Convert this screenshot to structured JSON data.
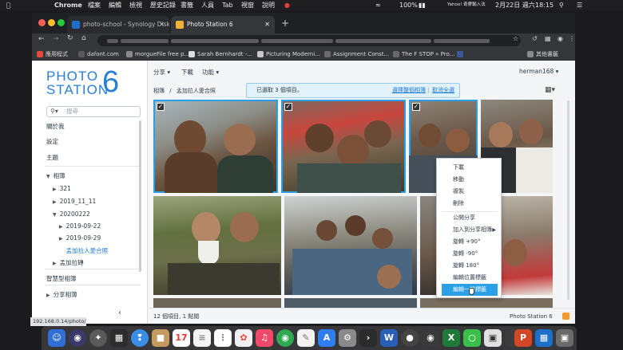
{
  "menubar": {
    "app": "Chrome",
    "menus": [
      "檔案",
      "編輯",
      "檢視",
      "歷史記錄",
      "書籤",
      "人員",
      "Tab",
      "視窗",
      "說明"
    ],
    "battery": "100%",
    "yahoo": "Yahoo! 奇摩輸入法",
    "date": "2月22日 週六",
    "time": "18:15"
  },
  "tabs": [
    {
      "title": "photo-school - Synology Disk",
      "active": false
    },
    {
      "title": "Photo Station 6",
      "active": true
    }
  ],
  "bookmarks": {
    "items": [
      "應用程式",
      "dafont.com",
      "morgueFile free p...",
      "Sarah Bernhardt -...",
      "Picturing Moderni...",
      "Assignment Const...",
      "The F STOP » Pro..."
    ],
    "other": "其他書籤"
  },
  "logo": {
    "line1": "PHOTO",
    "line2": "STATION",
    "number": "6"
  },
  "sidebar": {
    "search_placeholder": "搜尋",
    "items": [
      {
        "label": "關於我"
      },
      {
        "label": "設定"
      },
      {
        "label": "主題"
      },
      {
        "label": "相簿"
      },
      {
        "label": "321"
      },
      {
        "label": "2019_11_11"
      },
      {
        "label": "20200222"
      },
      {
        "label": "2019-09-22"
      },
      {
        "label": "2019-09-29"
      },
      {
        "label": "孟加拉人愛合照"
      },
      {
        "label": "孟加拉磚"
      },
      {
        "label": "智慧型相簿"
      },
      {
        "label": "分享相簿"
      }
    ],
    "collapse_icon": "chevron-left-icon"
  },
  "topbar": {
    "share": "分享",
    "download": "下載",
    "function": "功能",
    "user": "herman168"
  },
  "breadcrumb": {
    "root": "相簿",
    "sep": "/",
    "current": "孟加拉人愛合照"
  },
  "selection": {
    "text": "已選取 3 個項目。",
    "select_all": "選擇整個相簿",
    "cancel": "取消全選"
  },
  "context_menu": {
    "items": [
      "下載",
      "移動",
      "複製",
      "刪除",
      "公開分享",
      "加入到分享相簿",
      "旋轉 +90°",
      "旋轉 -90°",
      "旋轉 180°",
      "編輯位置標籤",
      "編輯一般標籤"
    ],
    "highlighted": "編輯一般標籤"
  },
  "footer": {
    "count": "12 個項目, 1 點閱",
    "brand": "Photo Station 6"
  },
  "status_url": "192.168.0.14/photo/#",
  "colors": {
    "accent": "#2ba0e7",
    "brand": "#2a7fd4"
  }
}
